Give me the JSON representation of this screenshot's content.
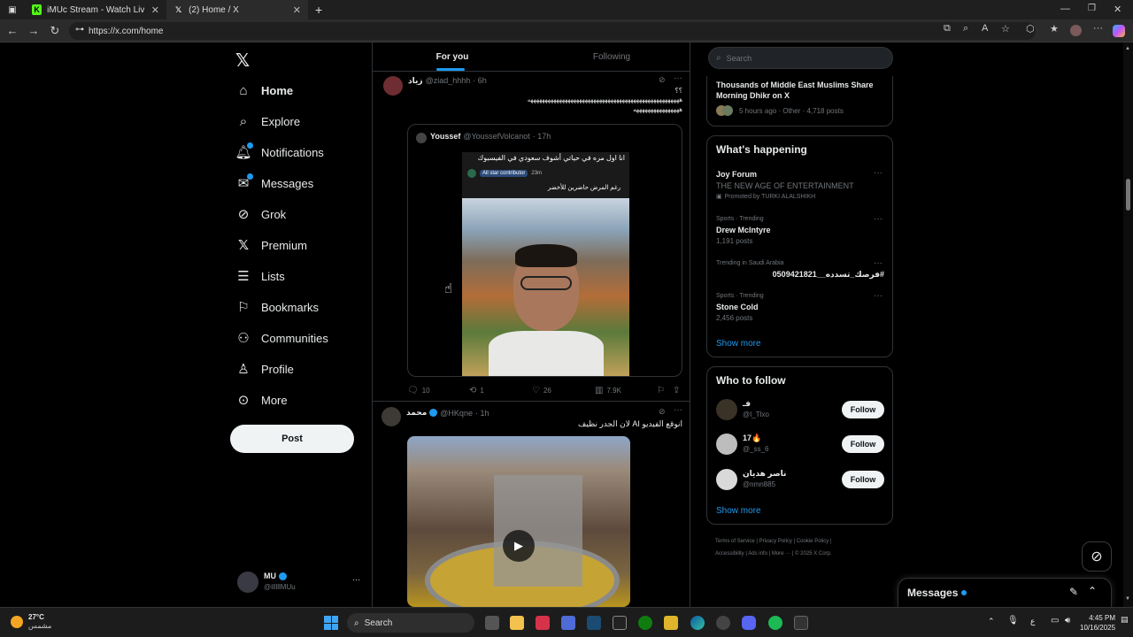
{
  "browser": {
    "tabs": [
      {
        "title": "iMUc Stream - Watch Live on Kick",
        "icon": "kick-icon"
      },
      {
        "title": "(2) Home / X",
        "icon": "x-icon"
      }
    ],
    "url": "https://x.com/home"
  },
  "nav": {
    "items": [
      {
        "label": "Home",
        "icon": "home-icon"
      },
      {
        "label": "Explore",
        "icon": "search-icon"
      },
      {
        "label": "Notifications",
        "icon": "bell-icon"
      },
      {
        "label": "Messages",
        "icon": "mail-icon"
      },
      {
        "label": "Grok",
        "icon": "grok-icon"
      },
      {
        "label": "Premium",
        "icon": "x-logo-icon"
      },
      {
        "label": "Lists",
        "icon": "list-icon"
      },
      {
        "label": "Bookmarks",
        "icon": "bookmark-icon"
      },
      {
        "label": "Communities",
        "icon": "people-icon"
      },
      {
        "label": "Profile",
        "icon": "person-icon"
      },
      {
        "label": "More",
        "icon": "more-circle-icon"
      }
    ],
    "post_label": "Post",
    "user": {
      "name": "MU",
      "handle": "@illlllMUu"
    }
  },
  "timeline": {
    "tabs": [
      "For you",
      "Following"
    ],
    "post1": {
      "name": "زياد",
      "handle": "@ziad_hhhh",
      "time": "· 6h",
      "text_line1": "؟؟",
      "text_line2": "هههههههههههههههههههههههههههههههههههههههههههههههههههههه",
      "text_line3": "ههههههههههههههههه",
      "quote": {
        "name": "Youssef",
        "handle": "@YoussefVolcanot",
        "time": "· 17h",
        "image_caption": "انا اول مره في حياتي أشوف سعودي في الفيسبوك",
        "image_badge": "All star contributor",
        "image_badge_time": "23m",
        "image_text": "رغم المرض حاضرين للأخضر"
      },
      "stats": {
        "replies": "10",
        "reposts": "1",
        "likes": "26",
        "views": "7.9K"
      }
    },
    "post2": {
      "name": "محمد",
      "handle": "@HKqne",
      "time": "· 1h",
      "text": "انوقع الفيديو AI لان الجدر نظيف"
    }
  },
  "right": {
    "search_placeholder": "Search",
    "news": {
      "title": "Thousands of Middle East Muslims Share Morning Dhikr on X",
      "meta": "5 hours ago · Other · 4,718 posts"
    },
    "happening": {
      "title": "What's happening",
      "items": [
        {
          "context": "Joy Forum",
          "title": "THE NEW AGE OF ENTERTAINMENT",
          "meta": "Promoted by TURKI ALALSHIKH"
        },
        {
          "context": "Sports · Trending",
          "title": "Drew McIntyre",
          "meta": "1,191 posts"
        },
        {
          "context": "Trending in Saudi Arabia",
          "title": "#فرصك_تسدده__0509421821",
          "meta": ""
        },
        {
          "context": "Sports · Trending",
          "title": "Stone Cold",
          "meta": "2,456 posts"
        }
      ],
      "show_more": "Show more"
    },
    "who_to_follow": {
      "title": "Who to follow",
      "users": [
        {
          "name": "فـ",
          "handle": "@I_Tlxo"
        },
        {
          "name": "17🔥",
          "handle": "@_ss_6"
        },
        {
          "name": "ناصر هديان",
          "handle": "@nmn885"
        }
      ],
      "follow_label": "Follow",
      "show_more": "Show more"
    },
    "footer": [
      "Terms of Service",
      "Privacy Policy",
      "Cookie Policy",
      "Accessibility",
      "Ads info",
      "More ···",
      "© 2025 X Corp."
    ]
  },
  "messages_drawer": {
    "label": "Messages"
  },
  "taskbar": {
    "weather_temp": "27°C",
    "weather_desc": "مشمس",
    "search_label": "Search",
    "lang": "ع",
    "time": "4:45 PM",
    "date": "10/16/2025"
  }
}
